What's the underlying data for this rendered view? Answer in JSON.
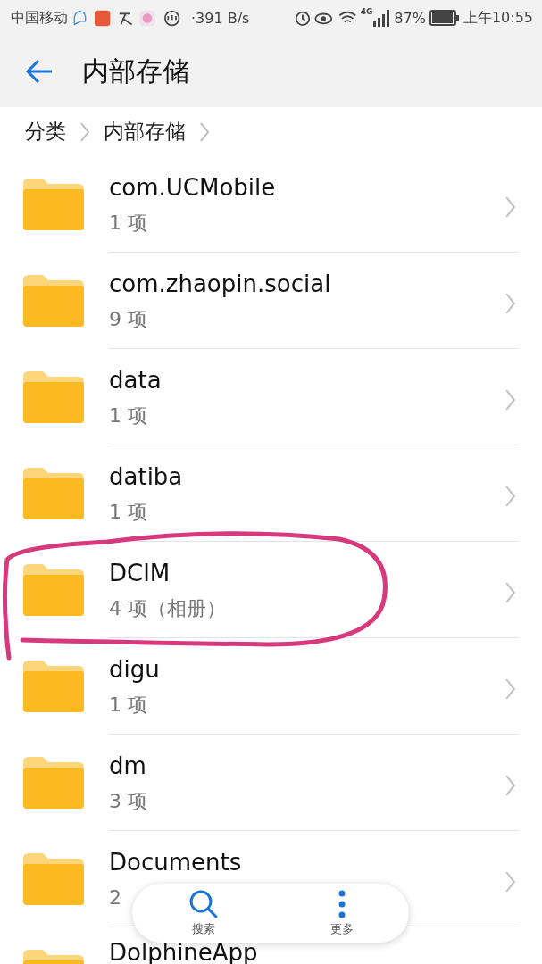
{
  "status_bar": {
    "carrier": "中国移动",
    "speed": "·391 B/s",
    "network": "4G",
    "battery": "87%",
    "time": "上午10:55"
  },
  "header": {
    "title": "内部存储"
  },
  "breadcrumb": [
    {
      "label": "分类"
    },
    {
      "label": "内部存储"
    }
  ],
  "folders": [
    {
      "name": "com.UCMobile",
      "count": "1 项",
      "highlighted": false
    },
    {
      "name": "com.zhaopin.social",
      "count": "9 项",
      "highlighted": false
    },
    {
      "name": "data",
      "count": "1 项",
      "highlighted": false
    },
    {
      "name": "datiba",
      "count": "1 项",
      "highlighted": false
    },
    {
      "name": "DCIM",
      "count": "4 项（相册）",
      "highlighted": true
    },
    {
      "name": "digu",
      "count": "1 项",
      "highlighted": false
    },
    {
      "name": "dm",
      "count": "3 项",
      "highlighted": false
    },
    {
      "name": "Documents",
      "count": "2",
      "highlighted": false
    },
    {
      "name": "DolphineApp",
      "highlighted": false
    }
  ],
  "bottom_bar": [
    {
      "kind": "search",
      "label": "搜索"
    },
    {
      "kind": "more",
      "label": "更多"
    }
  ]
}
